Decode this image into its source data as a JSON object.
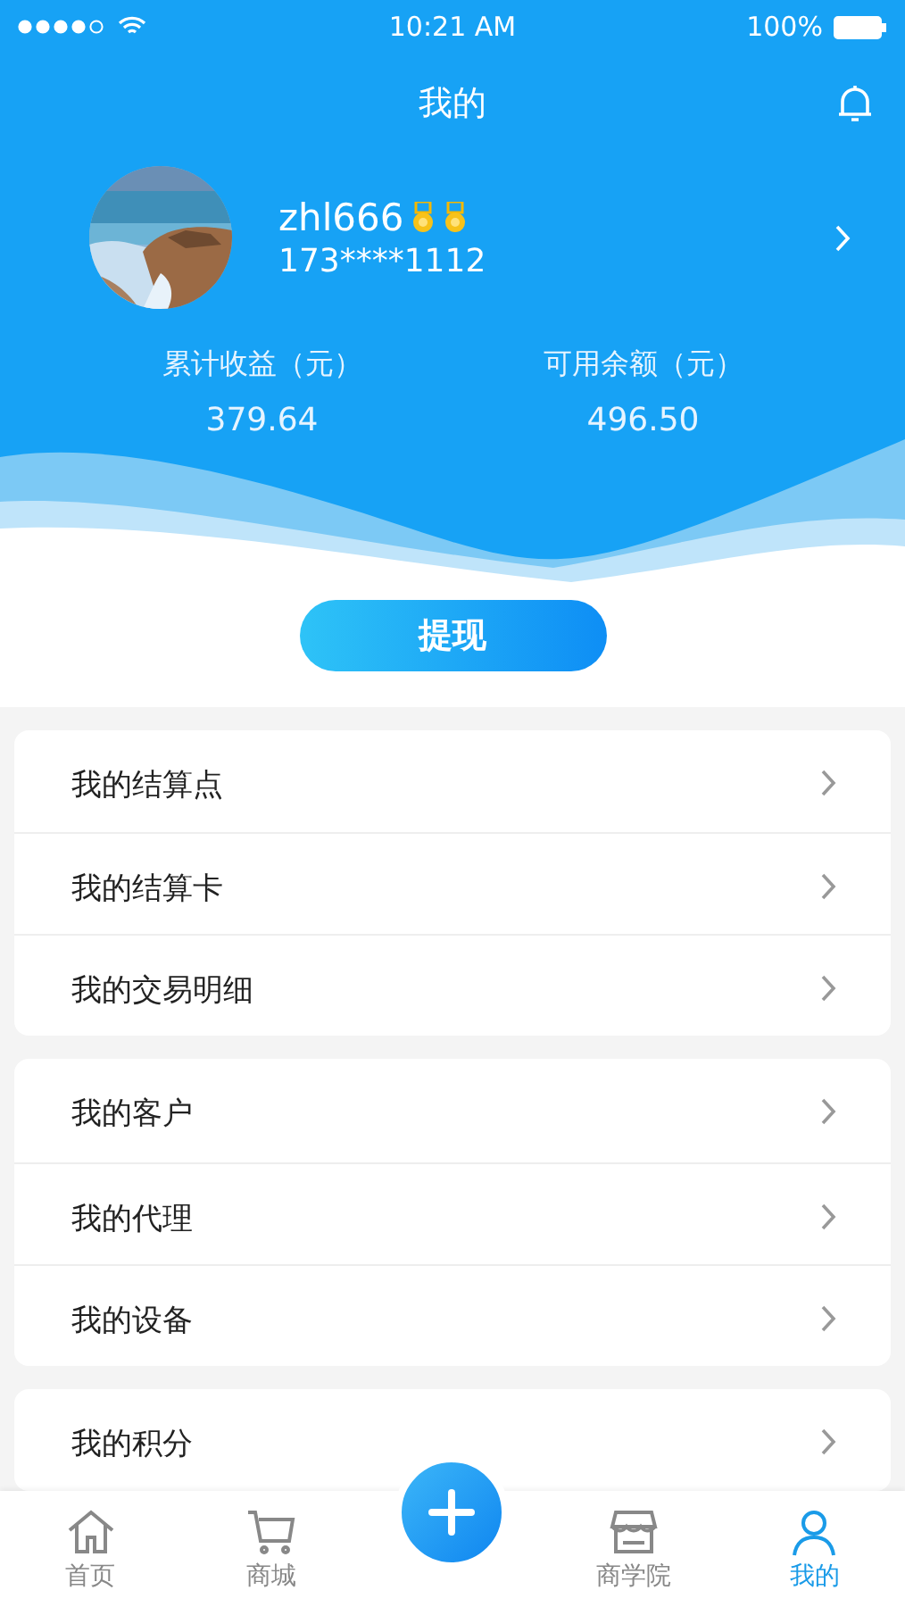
{
  "status_bar": {
    "time": "10:21 AM",
    "battery": "100%"
  },
  "header": {
    "title": "我的"
  },
  "profile": {
    "username": "zhl666",
    "medals": [
      {
        "kind": "medal"
      },
      {
        "kind": "medal"
      }
    ],
    "phone": "173****1112"
  },
  "stats": [
    {
      "label": "累计收益（元）",
      "value": "379.64"
    },
    {
      "label": "可用余额（元）",
      "value": "496.50"
    }
  ],
  "withdraw_button": "提现",
  "menu_groups": [
    {
      "items": [
        "我的结算点",
        "我的结算卡",
        "我的交易明细"
      ]
    },
    {
      "items": [
        "我的客户",
        "我的代理",
        "我的设备"
      ]
    },
    {
      "items": [
        "我的积分"
      ]
    }
  ],
  "tab_bar": [
    {
      "label": "首页",
      "kind": "home",
      "selected": false
    },
    {
      "label": "商城",
      "kind": "cart",
      "selected": false
    },
    {
      "kind": "plus",
      "selected": false
    },
    {
      "label": "商学院",
      "kind": "shop",
      "selected": false
    },
    {
      "label": "我的",
      "kind": "user",
      "selected": true
    }
  ]
}
